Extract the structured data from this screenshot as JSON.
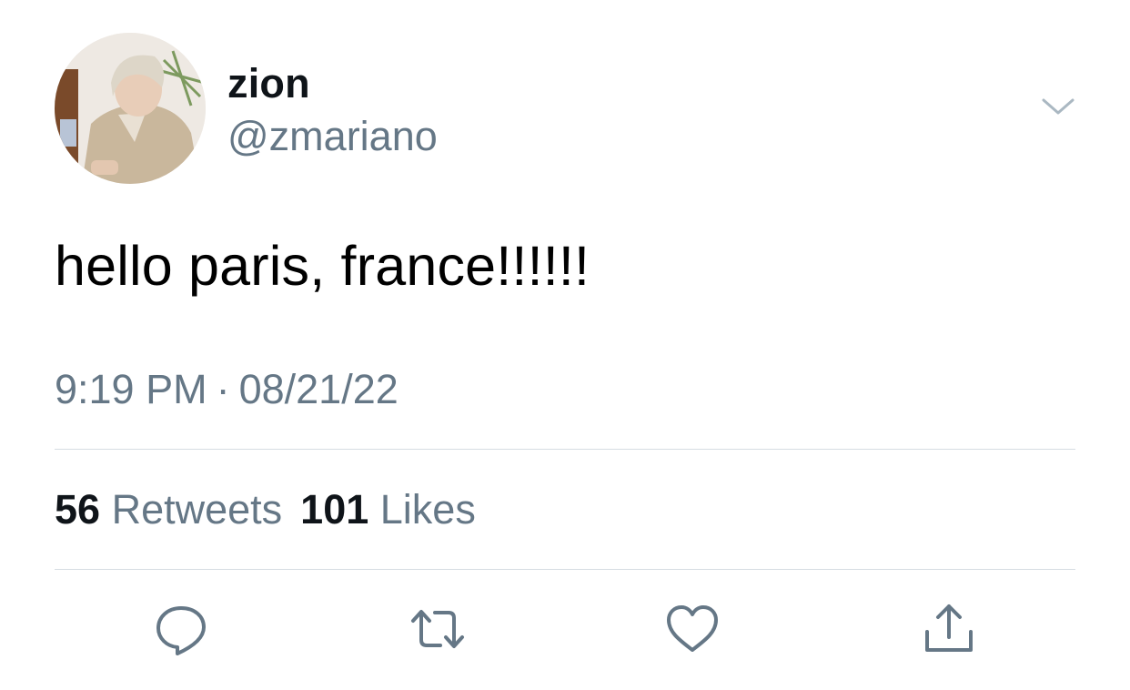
{
  "tweet": {
    "display_name": "zion",
    "handle": "@zmariano",
    "text": "hello paris, france!!!!!!",
    "time": "9:19 PM",
    "separator": "·",
    "date": "08/21/22"
  },
  "stats": {
    "retweets_count": "56",
    "retweets_label": "Retweets",
    "likes_count": "101",
    "likes_label": "Likes"
  },
  "icons": {
    "menu": "chevron-down-icon",
    "reply": "reply-icon",
    "retweet": "retweet-icon",
    "like": "heart-icon",
    "share": "share-icon"
  },
  "colors": {
    "text": "#0f1419",
    "secondary": "#657786",
    "divider": "#d6dde3"
  }
}
